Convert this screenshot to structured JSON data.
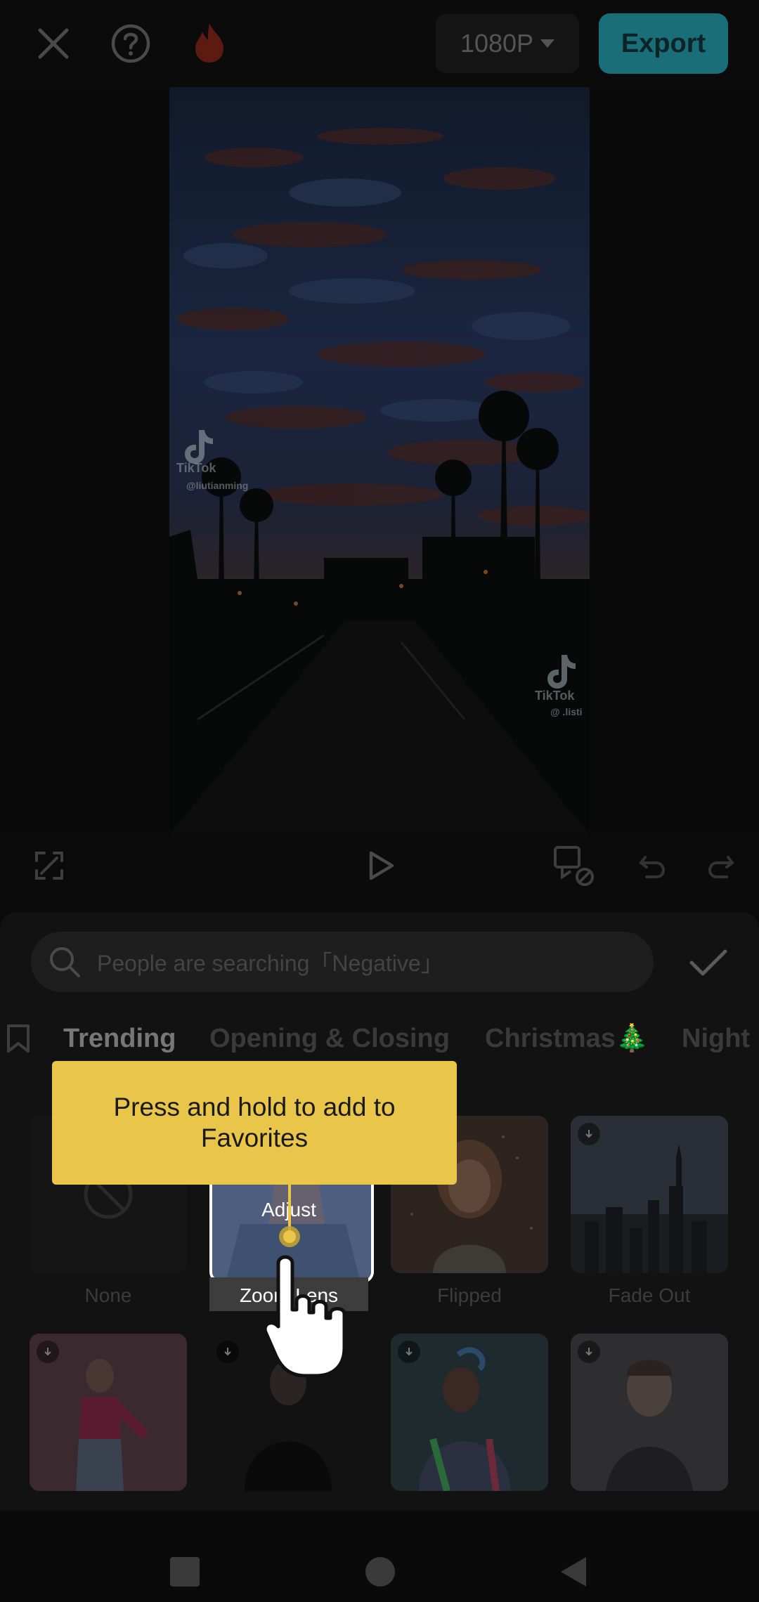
{
  "topbar": {
    "close_icon": "close-icon",
    "help_icon": "help-icon",
    "flame_icon": "flame-icon",
    "resolution": "1080P",
    "export_label": "Export"
  },
  "preview": {
    "watermark_top_brand": "TikTok",
    "watermark_top_user": "@liutianming",
    "watermark_bottom_brand": "TikTok",
    "watermark_bottom_user": "@ .listi"
  },
  "controls": {
    "fullscreen_icon": "fullscreen-icon",
    "play_icon": "play-icon",
    "keyframe_off_icon": "keyframe-off-icon",
    "undo_icon": "undo-icon",
    "redo_icon": "redo-icon"
  },
  "search": {
    "placeholder": "People are searching「Negative」",
    "confirm_icon": "check-icon"
  },
  "tabs": [
    {
      "label": "Trending",
      "active": true
    },
    {
      "label": "Opening & Closing",
      "active": false
    },
    {
      "label": "Christmas🎄",
      "active": false
    },
    {
      "label": "Night",
      "active": false
    }
  ],
  "effects_row1": [
    {
      "label": "None"
    },
    {
      "label": "Zoom Lens"
    },
    {
      "label": "Flipped"
    },
    {
      "label": "Fade Out"
    }
  ],
  "tooltip": {
    "text": "Press and hold to add to Favorites",
    "highlight_caption": "Adjust"
  },
  "colors": {
    "accent": "#1a6e78",
    "tooltip": "#e9c54a"
  }
}
